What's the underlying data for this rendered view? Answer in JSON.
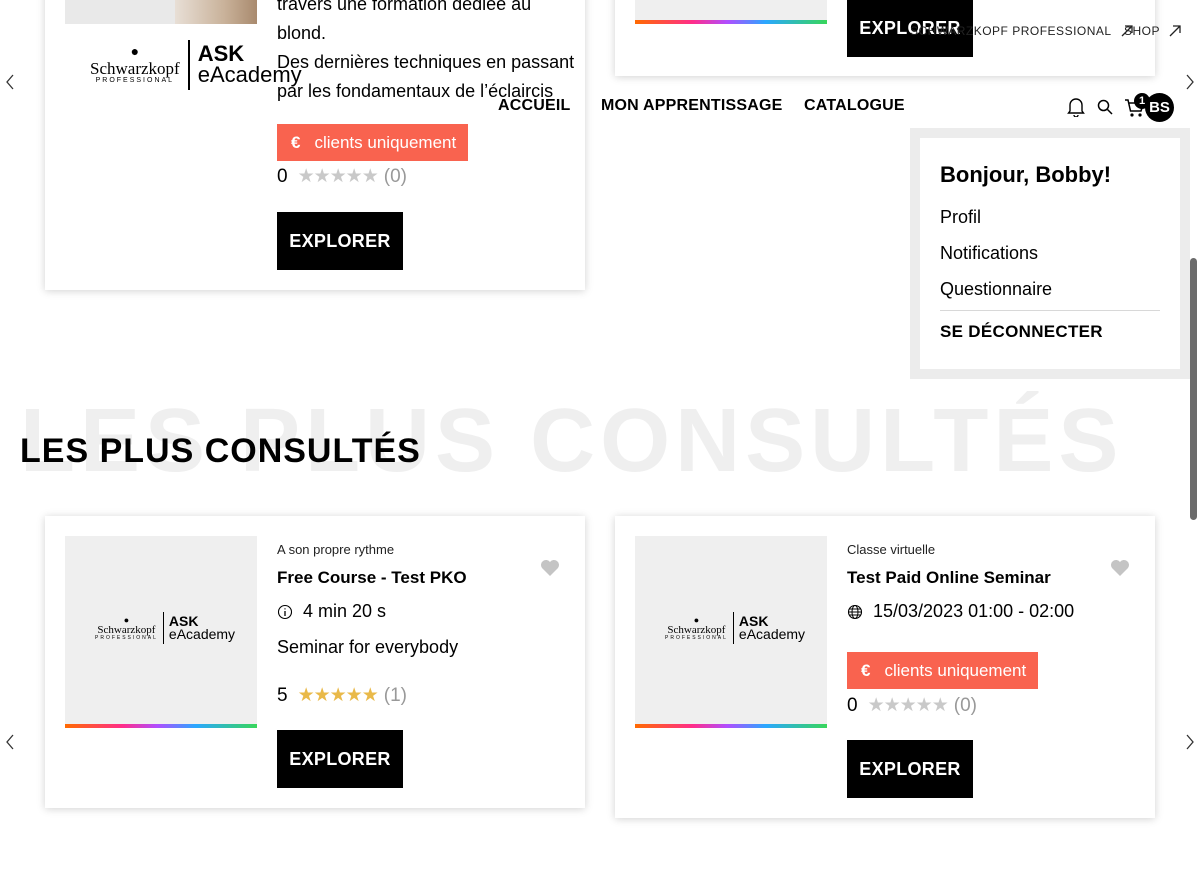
{
  "header": {
    "top_links": {
      "brand_label": "SCHWARZKOPF PROFESSIONAL",
      "shop_label": "SHOP"
    },
    "nav": {
      "home": "ACCUEIL",
      "learning": "MON APPRENTISSAGE",
      "catalog": "CATALOGUE"
    },
    "cart_count": "1",
    "avatar_initials": "BS",
    "icons": {
      "bell": "bell-icon",
      "search": "search-icon",
      "cart": "cart-icon",
      "external": "external-link-icon"
    }
  },
  "user_menu": {
    "greeting": "Bonjour, Bobby!",
    "items": [
      "Profil",
      "Notifications",
      "Questionnaire"
    ],
    "logout": "SE DÉCONNECTER"
  },
  "logo": {
    "brand": "Schwarzkopf",
    "brand_sub": "PROFESSIONAL",
    "ask": "ASK",
    "academy": "eAcademy"
  },
  "top_cards": [
    {
      "description_line1": "travers une formation dédiée au",
      "description_line2": "blond.",
      "description_line3": "Des dernières techniques en passant",
      "description_line4": "par les fondamentaux de l’éclaircis",
      "badge_currency": "€",
      "badge_label": "clients uniquement",
      "rating": "0",
      "rating_count": "(0)",
      "button": "EXPLORER"
    },
    {
      "button": "EXPLORER"
    }
  ],
  "section": {
    "title": "LES PLUS CONSULTÉS",
    "background_title": "LES PLUS CONSULTÉS"
  },
  "most_viewed": [
    {
      "type": "A son propre rythme",
      "title": "Free Course - Test PKO",
      "meta": "4 min 20 s",
      "meta_icon": "info-icon",
      "description": "Seminar for everybody",
      "rating": "5",
      "rating_count": "(1)",
      "button": "EXPLORER"
    },
    {
      "type": "Classe virtuelle",
      "title": "Test Paid Online Seminar",
      "meta": "15/03/2023 01:00 - 02:00",
      "meta_icon": "globe-icon",
      "badge_currency": "€",
      "badge_label": "clients uniquement",
      "rating": "0",
      "rating_count": "(0)",
      "button": "EXPLORER"
    }
  ],
  "stars": "★★★★★",
  "colors": {
    "badge": "#f9634f",
    "button": "#000000",
    "star_gold": "#e9b949",
    "star_grey": "#c9c9c9",
    "menu_frame": "#ececec"
  }
}
